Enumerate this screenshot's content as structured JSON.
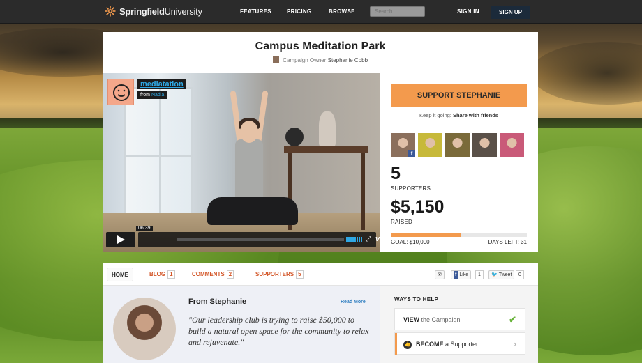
{
  "header": {
    "logo_bold": "Springfield",
    "logo_light": "University",
    "nav": [
      "FEATURES",
      "PRICING",
      "BROWSE"
    ],
    "search_placeholder": "Search",
    "sign_in": "SIGN IN",
    "sign_up": "SIGN UP"
  },
  "campaign": {
    "title": "Campus Meditation Park",
    "owner_label": "Campaign Owner",
    "owner_name": "Stephanie Cobb"
  },
  "video": {
    "title": "mediatation",
    "from_label": "from",
    "from_user": "Nadia",
    "time": "06:39",
    "brand": "vimeo"
  },
  "sidebar": {
    "support_button": "SUPPORT STEPHANIE",
    "keep_text": "Keep it going:",
    "share_link": "Share with friends",
    "supporters_count": "5",
    "supporters_label": "SUPPORTERS",
    "raised_amount": "$5,150",
    "raised_label": "RAISED",
    "progress_fraction": 0.52,
    "goal_text": "GOAL: $10,000",
    "days_left_text": "DAYS LEFT: 31",
    "supporter_avatars": [
      {
        "color": "#8b6f5c",
        "facebook": true
      },
      {
        "color": "#c7b93a",
        "facebook": false
      },
      {
        "color": "#7a6a3a",
        "facebook": false
      },
      {
        "color": "#5a5048",
        "facebook": false
      },
      {
        "color": "#c95a78",
        "facebook": false
      }
    ]
  },
  "tabs": [
    {
      "label": "HOME",
      "count": ""
    },
    {
      "label": "BLOG",
      "count": "1"
    },
    {
      "label": "COMMENTS",
      "count": "2"
    },
    {
      "label": "SUPPORTERS",
      "count": "5"
    }
  ],
  "share": {
    "like_label": "Like",
    "like_count": "1",
    "tweet_label": "Tweet",
    "tweet_count": "0"
  },
  "story": {
    "heading": "From Stephanie",
    "read_more": "Read More",
    "quote": "\"Our leadership club is trying to raise $50,000 to build a natural open space for the community to relax and rejuvenate.\""
  },
  "ways": {
    "title": "WAYS TO HELP",
    "item1_bold": "VIEW",
    "item1_rest": " the Campaign",
    "item2_bold": "BECOME",
    "item2_rest": " a Supporter"
  },
  "colors": {
    "accent_orange": "#f39a4d",
    "link_blue": "#2fa8e4",
    "tab_orange": "#d4582a",
    "dark_bar": "#2b2b2b"
  }
}
